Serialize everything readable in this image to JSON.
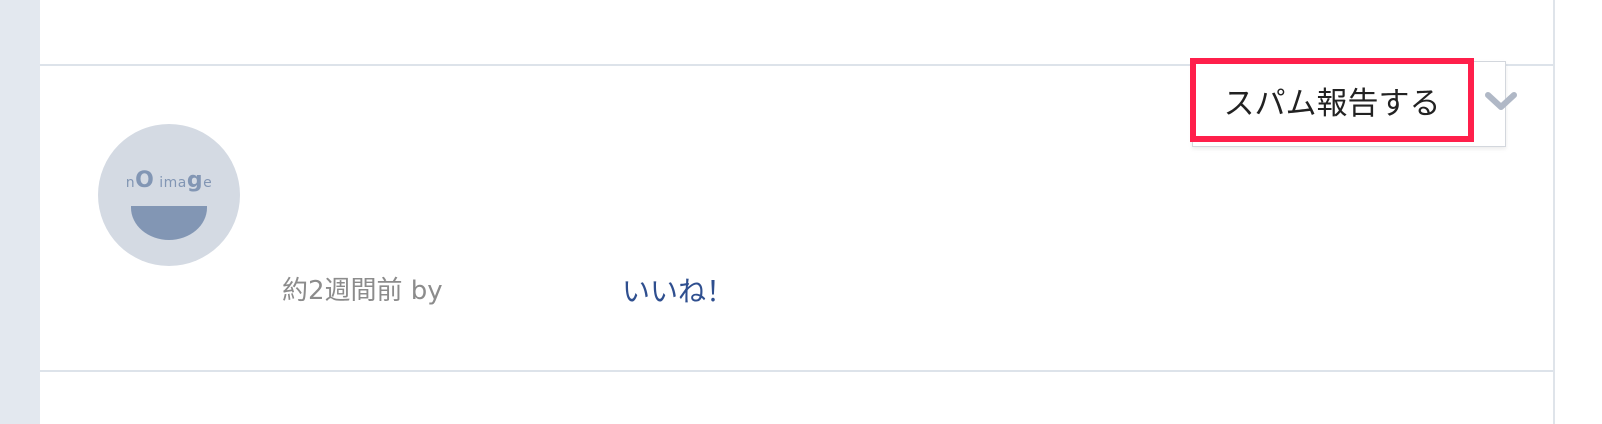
{
  "comment": {
    "avatar": {
      "image_text_small_left": "n",
      "image_text_bold_o": "O",
      "image_text_mid": " ima",
      "image_text_bold_g": "g",
      "image_text_end": "e"
    },
    "meta_text": "約2週間前 by",
    "like_label": "いいね！"
  },
  "menu": {
    "spam_report_label": "スパム報告する",
    "toggle_icon": "chevron-down-icon"
  },
  "colors": {
    "highlight": "#ff1f4b",
    "link": "#2f4f8f",
    "avatar_bg": "#d4dae3",
    "avatar_fg": "#8296b4",
    "rail": "#e3e8ef"
  }
}
